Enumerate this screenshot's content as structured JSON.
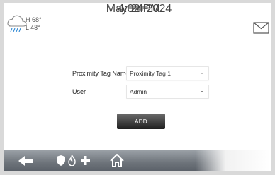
{
  "weather": {
    "icon": "rain-cloud-icon",
    "high": "H 68°",
    "low": "L 48°"
  },
  "clock": {
    "time": "4:02 PM",
    "date": "May 24 2024"
  },
  "messages_icon": "envelope-icon",
  "form": {
    "proximity_tag_label": "Proximity Tag Name",
    "proximity_tag_value": "Proximity Tag 1",
    "user_label": "User",
    "user_value": "Admin",
    "add_label": "ADD"
  },
  "navbar": {
    "icons": [
      "back-arrow-icon",
      "shield-icon",
      "flame-icon",
      "medical-cross-icon",
      "home-icon"
    ]
  }
}
